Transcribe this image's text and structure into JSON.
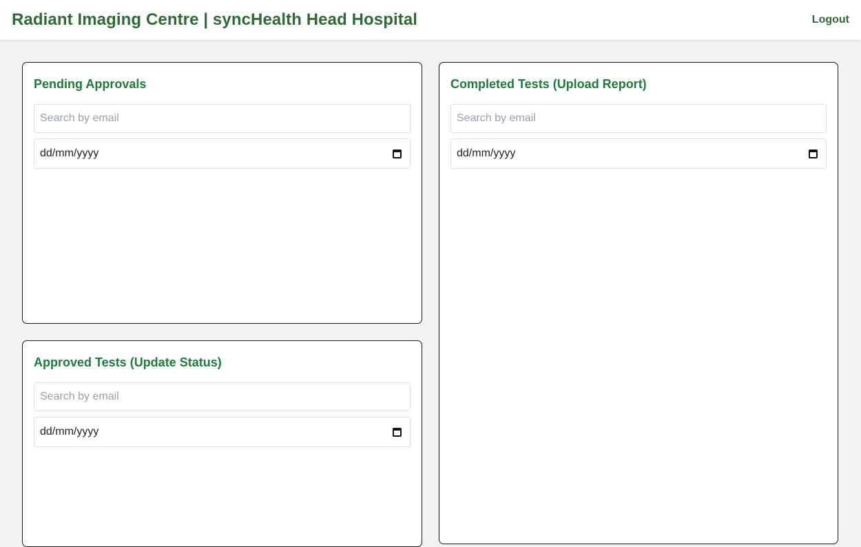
{
  "header": {
    "title": "Radiant Imaging Centre | syncHealth Head Hospital",
    "logout_label": "Logout"
  },
  "panels": {
    "pending": {
      "title": "Pending Approvals",
      "search_placeholder": "Search by email",
      "date_value": "dd/mm/yyyy"
    },
    "approved": {
      "title": "Approved Tests (Update Status)",
      "search_placeholder": "Search by email",
      "date_value": "dd/mm/yyyy"
    },
    "completed": {
      "title": "Completed Tests (Upload Report)",
      "search_placeholder": "Search by email",
      "date_value": "dd/mm/yyyy"
    }
  },
  "colors": {
    "brand": "#2f6b34",
    "panel_title": "#1e7a3c",
    "page_background": "#f2f3f5"
  },
  "icons": [
    "calendar-icon"
  ]
}
